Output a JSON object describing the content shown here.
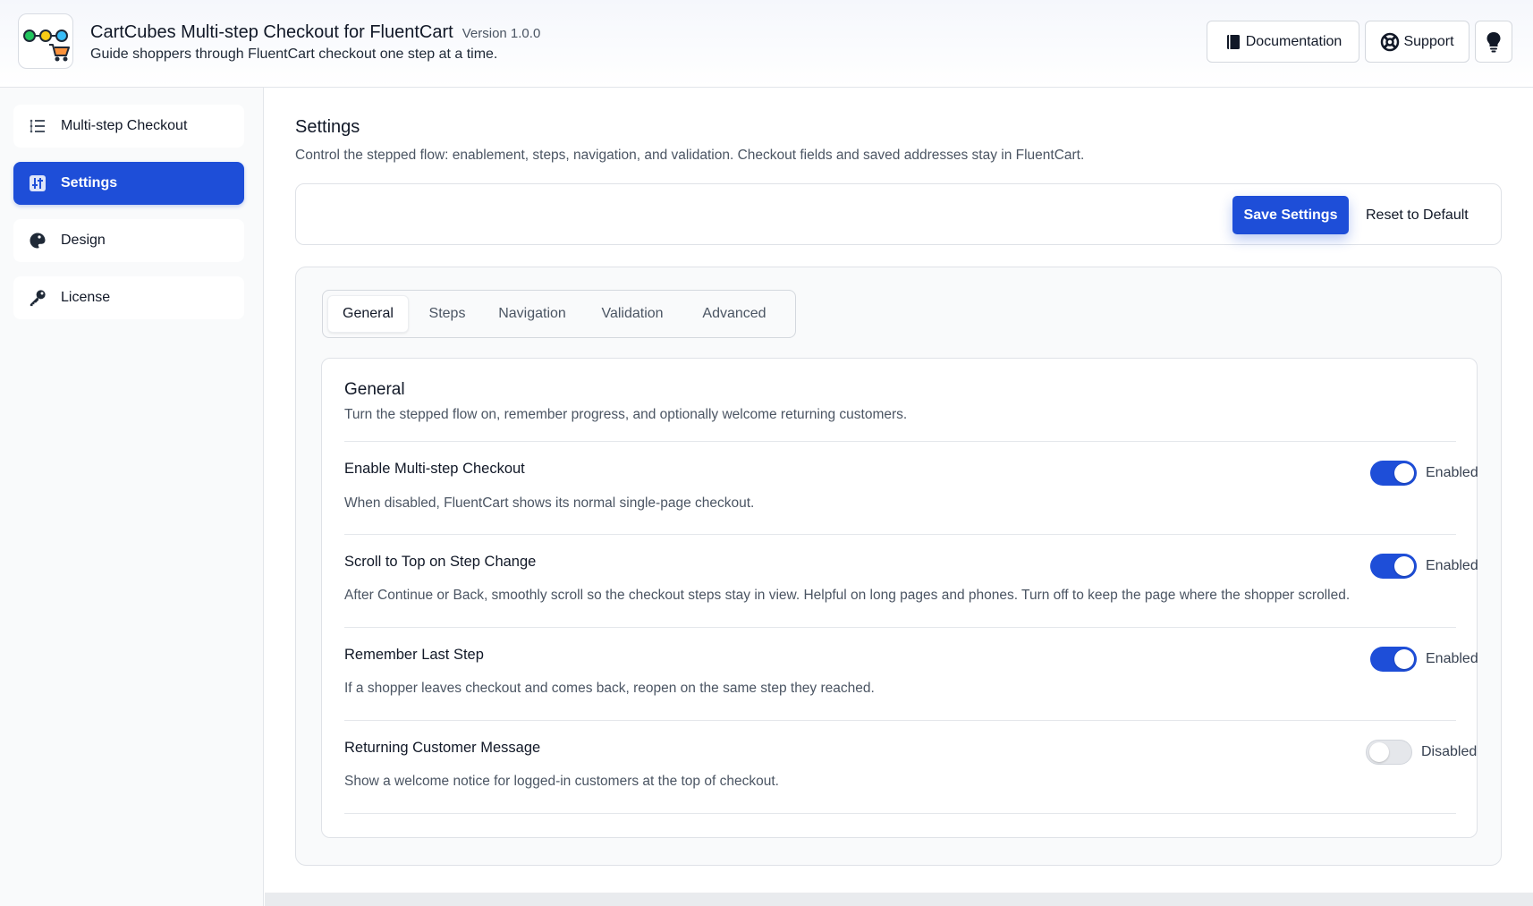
{
  "header": {
    "title": "CartCubes Multi-step Checkout for FluentCart",
    "version": "Version 1.0.0",
    "tagline": "Guide shoppers through FluentCart checkout one step at a time.",
    "logo_icon": "steps-cart-logo",
    "documentation_label": "Documentation",
    "support_label": "Support",
    "theme_icon": "lightbulb-icon"
  },
  "sidebar": {
    "items": [
      {
        "label": "Multi-step Checkout",
        "icon": "list-steps-icon",
        "active": false
      },
      {
        "label": "Settings",
        "icon": "settings-sliders-icon",
        "active": true
      },
      {
        "label": "Design",
        "icon": "palette-icon",
        "active": false
      },
      {
        "label": "License",
        "icon": "key-icon",
        "active": false
      }
    ]
  },
  "main": {
    "title": "Settings",
    "subtitle": "Control the stepped flow: enablement, steps, navigation, and validation. Checkout fields and saved addresses stay in FluentCart.",
    "save_label": "Save Settings",
    "reset_label": "Reset to Default",
    "tabs": [
      {
        "label": "General",
        "active": true
      },
      {
        "label": "Steps",
        "active": false
      },
      {
        "label": "Navigation",
        "active": false
      },
      {
        "label": "Validation",
        "active": false
      },
      {
        "label": "Advanced",
        "active": false
      }
    ],
    "section": {
      "title": "General",
      "subtitle": "Turn the stepped flow on, remember progress, and optionally welcome returning customers.",
      "rows": [
        {
          "title": "Enable Multi-step Checkout",
          "desc": "When disabled, FluentCart shows its normal single-page checkout.",
          "enabled": true,
          "state_label": "Enabled"
        },
        {
          "title": "Scroll to Top on Step Change",
          "desc": "After Continue or Back, smoothly scroll so the checkout steps stay in view. Helpful on long pages and phones. Turn off to keep the page where the shopper scrolled.",
          "enabled": true,
          "state_label": "Enabled"
        },
        {
          "title": "Remember Last Step",
          "desc": "If a shopper leaves checkout and comes back, reopen on the same step they reached.",
          "enabled": true,
          "state_label": "Enabled"
        },
        {
          "title": "Returning Customer Message",
          "desc": "Show a welcome notice for logged-in customers at the top of checkout.",
          "enabled": false,
          "state_label": "Disabled"
        }
      ]
    }
  },
  "colors": {
    "accent": "#1e4ed8",
    "text": "#111827",
    "muted": "#4b5563",
    "border": "#dfe2e7"
  }
}
